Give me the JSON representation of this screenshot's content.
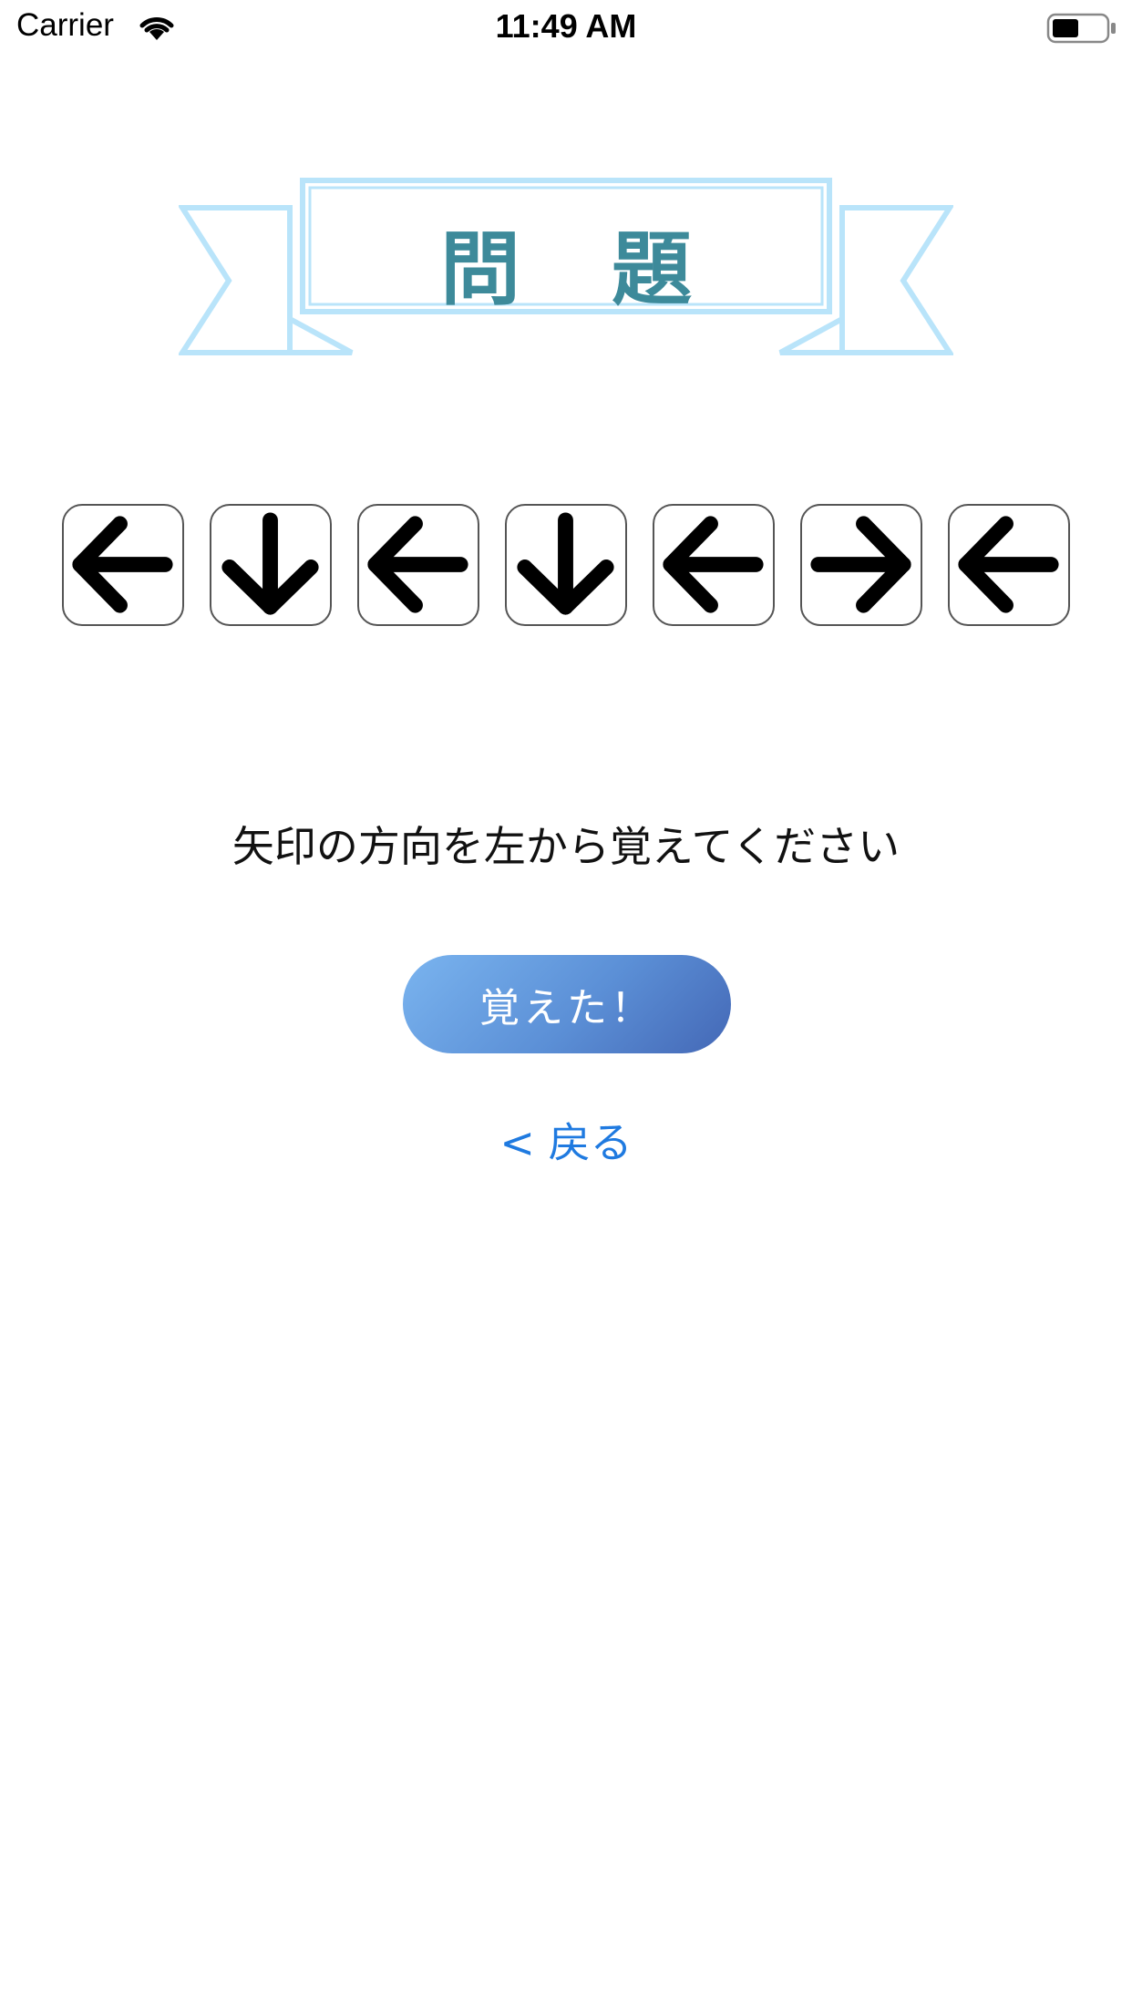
{
  "status_bar": {
    "carrier": "Carrier",
    "time": "11:49 AM",
    "battery_level": 0.5
  },
  "banner": {
    "title": "問題",
    "border_color": "#b9e4fa",
    "text_color": "#3d8a9a"
  },
  "arrows": [
    {
      "direction": "left",
      "icon": "arrow-left-icon"
    },
    {
      "direction": "down",
      "icon": "arrow-down-icon"
    },
    {
      "direction": "left",
      "icon": "arrow-left-icon"
    },
    {
      "direction": "down",
      "icon": "arrow-down-icon"
    },
    {
      "direction": "left",
      "icon": "arrow-left-icon"
    },
    {
      "direction": "right",
      "icon": "arrow-right-icon"
    },
    {
      "direction": "left",
      "icon": "arrow-left-icon"
    }
  ],
  "instruction": "矢印の方向を左から覚えてください",
  "remember_button": {
    "label": "覚えた！",
    "colors": [
      "#7ab4ef",
      "#4468b6"
    ]
  },
  "back_link": {
    "label": "< 戻る",
    "color": "#1f7ae0"
  }
}
